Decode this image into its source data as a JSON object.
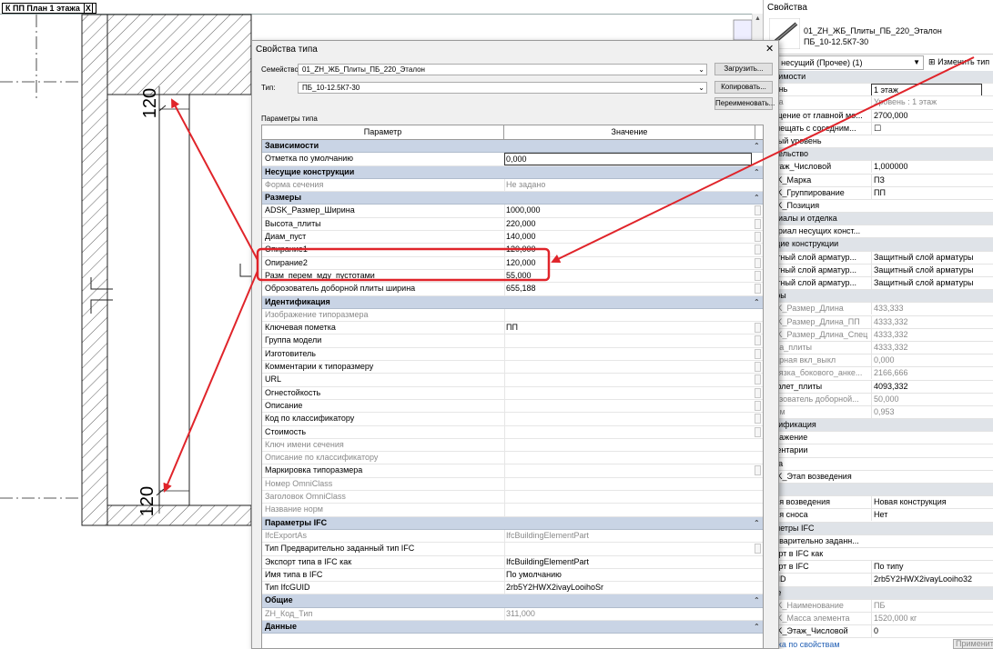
{
  "view_tab": {
    "label": "К ПП План 1 этажа",
    "close": "X"
  },
  "drawing": {
    "dim_top": "120",
    "dim_bottom": "120"
  },
  "palette": {
    "title": "Свойства",
    "type_name_line1": "01_ZH_ЖБ_Плиты_ПБ_220_Эталон",
    "type_name_line2": "ПБ_10-12.5К7-30",
    "instance_selector": "кас несущий (Прочее) (1)",
    "edit_type": "Изменить тип",
    "rows": [
      {
        "kind": "group",
        "name": "висимости"
      },
      {
        "kind": "row",
        "name": "овень",
        "value": "1 этаж",
        "box": true
      },
      {
        "kind": "row",
        "name": "нова",
        "value": "Уровень : 1 этаж",
        "dim": true
      },
      {
        "kind": "row",
        "name": "мещение от главной мо...",
        "value": "2700,000"
      },
      {
        "kind": "row",
        "name": "ремещать с соседним...",
        "value": "☐"
      },
      {
        "kind": "row",
        "name": "зовый уровень",
        "value": ""
      },
      {
        "kind": "group",
        "name": "оительство"
      },
      {
        "kind": "row",
        "name": "_Этаж_Числовой",
        "value": "1,000000"
      },
      {
        "kind": "row",
        "name": "DSK_Марка",
        "value": "ПЗ"
      },
      {
        "kind": "row",
        "name": "DSK_Группирование",
        "value": "ПП"
      },
      {
        "kind": "row",
        "name": "DSK_Позиция",
        "value": ""
      },
      {
        "kind": "group",
        "name": "териалы и отделка"
      },
      {
        "kind": "row",
        "name": "атериал несущих конст...",
        "value": ""
      },
      {
        "kind": "group",
        "name": "сущие конструкции"
      },
      {
        "kind": "row",
        "name": "щитный слой арматур...",
        "value": "Защитный слой арматуры"
      },
      {
        "kind": "row",
        "name": "щитный слой арматур...",
        "value": "Защитный слой арматуры"
      },
      {
        "kind": "row",
        "name": "щитный слой арматур...",
        "value": "Защитный слой арматуры"
      },
      {
        "kind": "group",
        "name": "меры"
      },
      {
        "kind": "row",
        "name": "DSK_Размер_Длина",
        "value": "433,333",
        "dim": true
      },
      {
        "kind": "row",
        "name": "DSK_Размер_Длина_ПП",
        "value": "4333,332",
        "dim": true
      },
      {
        "kind": "row",
        "name": "DSK_Размер_Длина_Спец",
        "value": "4333,332",
        "dim": true
      },
      {
        "kind": "row",
        "name": "лина_плиты",
        "value": "4333,332",
        "dim": true
      },
      {
        "kind": "row",
        "name": "оборная вкл_выкл",
        "value": "0,000",
        "dim": true
      },
      {
        "kind": "row",
        "name": "ривязка_бокового_анке...",
        "value": "2166,666",
        "dim": true
      },
      {
        "kind": "row",
        "name": "рофлет_плиты",
        "value": "4093,332"
      },
      {
        "kind": "row",
        "name": "брозователь доборной...",
        "value": "50,000",
        "dim": true
      },
      {
        "kind": "row",
        "name": "бъем",
        "value": "0,953",
        "dim": true
      },
      {
        "kind": "group",
        "name": "ентификация"
      },
      {
        "kind": "row",
        "name": "ображение",
        "value": ""
      },
      {
        "kind": "row",
        "name": "мментарии",
        "value": ""
      },
      {
        "kind": "row",
        "name": "арка",
        "value": ""
      },
      {
        "kind": "row",
        "name": "DSK_Этап возведения",
        "value": ""
      },
      {
        "kind": "group",
        "name": "дии"
      },
      {
        "kind": "row",
        "name": "адия возведения",
        "value": "Новая конструкция"
      },
      {
        "kind": "row",
        "name": "адия сноса",
        "value": "Нет"
      },
      {
        "kind": "group",
        "name": "раметры IFC"
      },
      {
        "kind": "row",
        "name": "редварительно заданн...",
        "value": ""
      },
      {
        "kind": "row",
        "name": "спорт в IFC как",
        "value": ""
      },
      {
        "kind": "row",
        "name": "спорт в IFC",
        "value": "По типу"
      },
      {
        "kind": "row",
        "name": "GUID",
        "value": "2rb5Y2HWX2ivayLooiho32"
      },
      {
        "kind": "group",
        "name": "щие"
      },
      {
        "kind": "row",
        "name": "DSK_Наименование",
        "value": "ПБ",
        "dim": true
      },
      {
        "kind": "row",
        "name": "DSK_Масса элемента",
        "value": "1520,000 кг",
        "dim": true
      },
      {
        "kind": "row",
        "name": "DSK_Этаж_Числовой",
        "value": "0"
      }
    ],
    "link": "авка по свойствам",
    "apply": "Применить"
  },
  "dialog": {
    "title": "Свойства типа",
    "family_label": "Семейство:",
    "family_value": "01_ZH_ЖБ_Плиты_ПБ_220_Эталон",
    "type_label": "Тип:",
    "type_value": "ПБ_10-12.5К7-30",
    "load_button": "Загрузить...",
    "copy_button": "Копировать...",
    "rename_button": "Переименовать...",
    "section_label": "Параметры типа",
    "col_param": "Параметр",
    "col_value": "Значение",
    "rows": [
      {
        "kind": "group",
        "name": "Зависимости"
      },
      {
        "kind": "row",
        "name": "Отметка по умолчанию",
        "value": "0,000",
        "box": true
      },
      {
        "kind": "group",
        "name": "Несущие конструкции"
      },
      {
        "kind": "row",
        "name": "Форма сечения",
        "value": "Не задано",
        "dim": true
      },
      {
        "kind": "group",
        "name": "Размеры"
      },
      {
        "kind": "row",
        "name": "ADSK_Размер_Ширина",
        "value": "1000,000",
        "sb": true
      },
      {
        "kind": "row",
        "name": "Высота_плиты",
        "value": "220,000",
        "sb": true
      },
      {
        "kind": "row",
        "name": "Диам_пуст",
        "value": "140,000",
        "sb": true
      },
      {
        "kind": "row",
        "name": "Опирание1",
        "value": "120,000",
        "sb": true
      },
      {
        "kind": "row",
        "name": "Опирание2",
        "value": "120,000",
        "sb": true
      },
      {
        "kind": "row",
        "name": "Разм_перем_мду_пустотами",
        "value": "55,000",
        "sb": true
      },
      {
        "kind": "row",
        "name": "Оброзователь доборной плиты ширина",
        "value": "655,188",
        "sb": true
      },
      {
        "kind": "group",
        "name": "Идентификация"
      },
      {
        "kind": "row",
        "name": "Изображение типоразмера",
        "value": "",
        "dim": true
      },
      {
        "kind": "row",
        "name": "Ключевая пометка",
        "value": "ПП",
        "sb": true
      },
      {
        "kind": "row",
        "name": "Группа модели",
        "value": "",
        "sb": true
      },
      {
        "kind": "row",
        "name": "Изготовитель",
        "value": "",
        "sb": true
      },
      {
        "kind": "row",
        "name": "Комментарии к типоразмеру",
        "value": "",
        "sb": true
      },
      {
        "kind": "row",
        "name": "URL",
        "value": "",
        "sb": true
      },
      {
        "kind": "row",
        "name": "Огнестойкость",
        "value": "",
        "sb": true
      },
      {
        "kind": "row",
        "name": "Описание",
        "value": "",
        "sb": true
      },
      {
        "kind": "row",
        "name": "Код по классификатору",
        "value": "",
        "sb": true
      },
      {
        "kind": "row",
        "name": "Стоимость",
        "value": "",
        "sb": true
      },
      {
        "kind": "row",
        "name": "Ключ имени сечения",
        "value": "",
        "dim": true
      },
      {
        "kind": "row",
        "name": "Описание по классификатору",
        "value": "",
        "dim": true
      },
      {
        "kind": "row",
        "name": "Маркировка типоразмера",
        "value": "",
        "sb": true
      },
      {
        "kind": "row",
        "name": "Номер OmniClass",
        "value": "",
        "dim": true
      },
      {
        "kind": "row",
        "name": "Заголовок OmniClass",
        "value": "",
        "dim": true
      },
      {
        "kind": "row",
        "name": "Название норм",
        "value": "",
        "dim": true
      },
      {
        "kind": "group",
        "name": "Параметры IFC"
      },
      {
        "kind": "row",
        "name": "IfcExportAs",
        "value": "IfcBuildingElementPart",
        "dim": true
      },
      {
        "kind": "row",
        "name": "Тип Предварительно заданный тип IFC",
        "value": "",
        "sb": true
      },
      {
        "kind": "row",
        "name": "Экспорт типа в IFC как",
        "value": "IfcBuildingElementPart"
      },
      {
        "kind": "row",
        "name": "Имя типа в IFC",
        "value": "По умолчанию"
      },
      {
        "kind": "row",
        "name": "Тип IfcGUID",
        "value": "2rb5Y2HWX2ivayLooihoSr"
      },
      {
        "kind": "group",
        "name": "Общие"
      },
      {
        "kind": "row",
        "name": "ZH_Код_Тип",
        "value": "311,000",
        "dim": true
      },
      {
        "kind": "group",
        "name": "Данные"
      }
    ]
  },
  "colors": {
    "highlight": "#e0242a",
    "group_bg": "#c9d4e5",
    "link": "#2461b5"
  }
}
